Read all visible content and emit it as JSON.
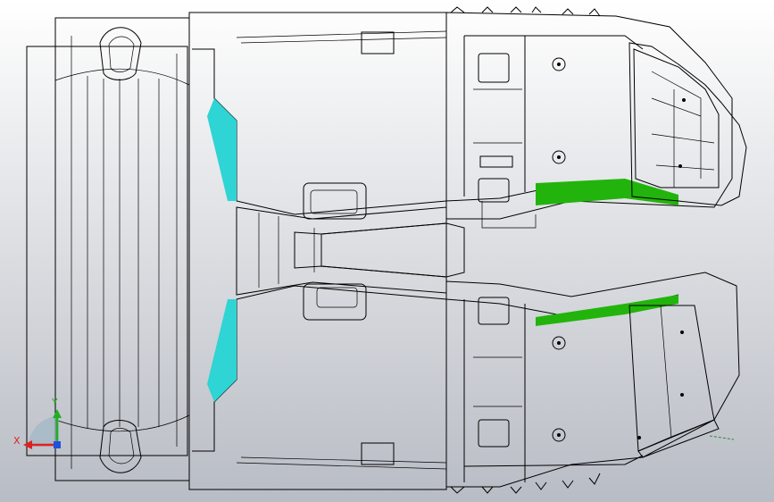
{
  "viewport": {
    "background_top": "#ffffff",
    "background_bottom": "#b8bcc4"
  },
  "model": {
    "colors": {
      "cyan_part": "#00ffff",
      "cyan_shade": "#2fd4d4",
      "pale_cyan": "#a8ffff",
      "green_part": "#33ee11",
      "green_shade": "#22b40c",
      "olive": "#8db43b",
      "purple_part": "#a010e8",
      "purple_shade": "#d06af2",
      "brown_part": "#b4696c",
      "brown_shade": "#7a3a3c",
      "light_blue": "#33ccee"
    }
  },
  "triad": {
    "x_label": "X",
    "y_label": "Y",
    "x_color": "#e02020",
    "y_color": "#20b020",
    "z_color": "#2050e0"
  }
}
